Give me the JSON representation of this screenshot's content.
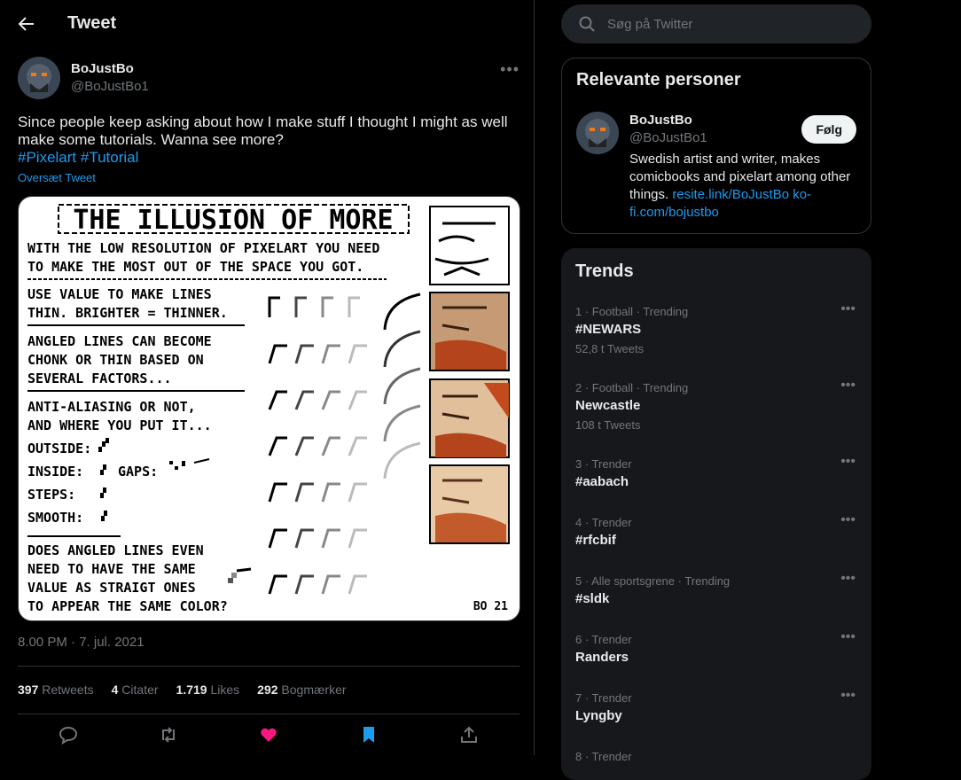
{
  "header": {
    "title": "Tweet"
  },
  "tweet": {
    "author_name": "BoJustBo",
    "author_handle": "@BoJustBo1",
    "text": "Since people keep asking about how I make stuff I thought I might as well make some tutorials. Wanna see more?",
    "hashtags": [
      "#Pixelart",
      "#Tutorial"
    ],
    "translate_label": "Oversæt Tweet",
    "timestamp": "8.00 PM · 7. jul. 2021",
    "stats": [
      {
        "count": "397",
        "label": "Retweets"
      },
      {
        "count": "4",
        "label": "Citater"
      },
      {
        "count": "1.719",
        "label": "Likes"
      },
      {
        "count": "292",
        "label": "Bogmærker"
      }
    ],
    "image": {
      "title": "THE ILLUSION OF MORE",
      "intro": [
        "WITH THE LOW RESOLUTION OF PIXELART YOU NEED",
        "TO MAKE THE MOST OUT OF THE SPACE YOU GOT."
      ],
      "s1": [
        "USE VALUE TO MAKE LINES",
        "THIN. BRIGHTER = THINNER."
      ],
      "s2": [
        "ANGLED LINES CAN BECOME",
        "CHONK OR THIN BASED ON",
        "SEVERAL FACTORS..."
      ],
      "s3": [
        "ANTI-ALIASING OR NOT,",
        "AND WHERE YOU PUT IT..."
      ],
      "outside": "OUTSIDE:",
      "inside": "INSIDE:",
      "gaps": "GAPS:",
      "steps": "STEPS:",
      "smooth": "SMOOTH:",
      "s4": [
        "DOES ANGLED LINES EVEN",
        "NEED TO HAVE THE SAME",
        "VALUE AS STRAIGT ONES",
        "TO APPEAR THE SAME COLOR?"
      ],
      "signature": "BO 21"
    }
  },
  "search": {
    "placeholder": "Søg på Twitter"
  },
  "relevant": {
    "title": "Relevante personer",
    "name": "BoJustBo",
    "handle": "@BoJustBo1",
    "bio": "Swedish artist and writer, makes comicbooks and pixelart among other things.",
    "links": [
      "resite.link/BoJustBo",
      "ko-fi.com/bojustbo"
    ],
    "follow_label": "Følg"
  },
  "trends": {
    "title": "Trends",
    "items": [
      {
        "meta": "1 · Football · Trending",
        "name": "#NEWARS",
        "count": "52,8 t Tweets"
      },
      {
        "meta": "2 · Football · Trending",
        "name": "Newcastle",
        "count": "108 t Tweets"
      },
      {
        "meta": "3 · Trender",
        "name": "#aabach"
      },
      {
        "meta": "4 · Trender",
        "name": "#rfcbif"
      },
      {
        "meta": "5 · Alle sportsgrene · Trending",
        "name": "#sldk"
      },
      {
        "meta": "6 · Trender",
        "name": "Randers"
      },
      {
        "meta": "7 · Trender",
        "name": "Lyngby"
      },
      {
        "meta": "8 · Trender"
      }
    ]
  },
  "colors": {
    "accent": "#1d9bf0",
    "like": "#f91880",
    "bookmark": "#1d9bf0",
    "background": "#000000"
  }
}
